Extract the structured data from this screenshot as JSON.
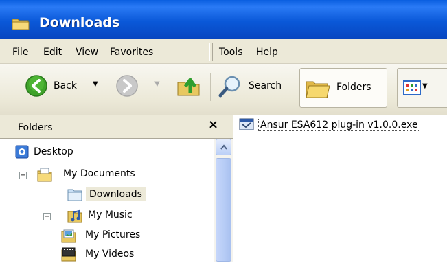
{
  "window": {
    "title": "Downloads",
    "icon": "folder-icon"
  },
  "menu": [
    "File",
    "Edit",
    "View",
    "Favorites",
    "Tools",
    "Help"
  ],
  "toolbar": {
    "back_label": "Back",
    "search_label": "Search",
    "folders_label": "Folders",
    "icons": [
      "back-arrow-icon",
      "forward-arrow-icon",
      "up-folder-icon",
      "search-magnifier-icon",
      "folders-icon",
      "views-icon"
    ]
  },
  "folders_pane": {
    "title": "Folders",
    "close_glyph": "×",
    "tree": [
      {
        "label": "Desktop",
        "icon": "desktop-icon",
        "level": 0,
        "expander": ""
      },
      {
        "label": "My Documents",
        "icon": "my-documents-icon",
        "level": 1,
        "expander": "−"
      },
      {
        "label": "Downloads",
        "icon": "folder-icon",
        "level": 2,
        "expander": "",
        "selected": true
      },
      {
        "label": "My Music",
        "icon": "my-music-icon",
        "level": 2,
        "expander": "+"
      },
      {
        "label": "My Pictures",
        "icon": "my-pictures-icon",
        "level": 2,
        "expander": ""
      },
      {
        "label": "My Videos",
        "icon": "my-videos-icon",
        "level": 2,
        "expander": ""
      }
    ]
  },
  "files": [
    {
      "name": "Ansur ESA612 plug-in v1.0.0.exe",
      "icon": "installer-icon"
    }
  ],
  "colors": {
    "titlebar": "#0a58d8",
    "chrome": "#ece9d8",
    "selection": "#ece9d8"
  }
}
